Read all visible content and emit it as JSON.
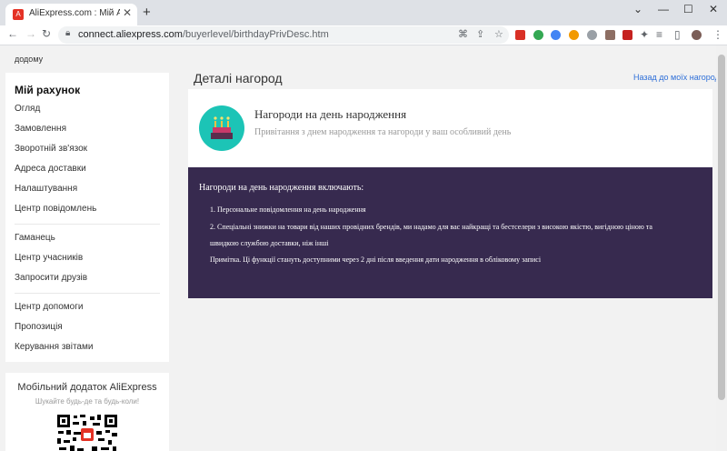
{
  "browser": {
    "tab_title": "AliExpress.com : Мій AliExpress",
    "tab_close": "✕",
    "new_tab": "+",
    "url_host": "connect.aliexpress.com",
    "url_path": "/buyerlevel/birthdayPrivDesc.htm",
    "controls": {
      "minimize": "—",
      "maximize": "☐",
      "close": "✕",
      "dropdown": "⌄"
    }
  },
  "breadcrumb": {
    "home": "додому"
  },
  "sidebar": {
    "title": "Мій рахунок",
    "group1": [
      "Огляд",
      "Замовлення",
      "Зворотній зв'язок",
      "Адреса доставки",
      "Налаштування",
      "Центр повідомлень"
    ],
    "group2": [
      "Гаманець",
      "Центр учасників",
      "Запросити друзів"
    ],
    "group3": [
      "Центр допомоги",
      "Пропозиція",
      "Керування звітами"
    ]
  },
  "app_promo": {
    "title": "Мобільний додаток AliExpress",
    "subtitle": "Шукайте будь-де та будь-коли!"
  },
  "main": {
    "title": "Деталі нагород",
    "back_link": "Назад до моїх нагород",
    "card_title": "Нагороди на день народження",
    "card_subtitle": "Привітання з днем народження та нагороди у ваш особливий день",
    "info_heading": "Нагороди на день народження включають:",
    "item1": "1. Персональне повідомлення на день народження",
    "item2_line1": "2. Спеціальні знижки на товари від наших провідних брендів, ми надамо для вас найкращі та бестселери з високою якістю, вигідною ціною та",
    "item2_line2": "швидкою службою доставки, ніж інші",
    "note": "Примітка. Ці функції стануть доступними через 2 дні після введення дати народження в обліковому записі"
  },
  "colors": {
    "accent": "#e43225",
    "info_bg": "#372a4f",
    "teal": "#1cc4b6",
    "link": "#2e6fd8"
  }
}
